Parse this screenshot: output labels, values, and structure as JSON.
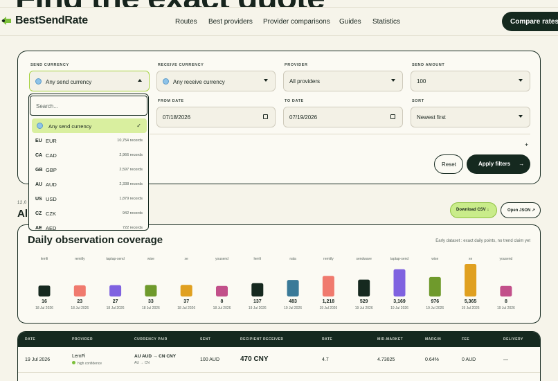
{
  "hero": {
    "title": "Find the exact quote"
  },
  "nav": {
    "brand": "BestSendRate",
    "links": [
      "Routes",
      "Best providers",
      "Provider comparisons",
      "Guides",
      "Statistics"
    ],
    "cta": "Compare rates"
  },
  "filters": {
    "send_currency": {
      "label": "SEND CURRENCY",
      "value": "Any send currency"
    },
    "receive_currency": {
      "label": "RECEIVE CURRENCY",
      "value": "Any receive currency"
    },
    "provider": {
      "label": "PROVIDER",
      "value": "All providers"
    },
    "send_amount": {
      "label": "SEND AMOUNT",
      "value": "100"
    },
    "from_date": {
      "label": "FROM DATE",
      "value": "07/18/2026"
    },
    "to_date": {
      "label": "TO DATE",
      "value": "07/19/2026"
    },
    "sort": {
      "label": "SORT",
      "value": "Newest first"
    },
    "plus": "+",
    "reset": "Reset",
    "apply": "Apply filters",
    "apply_arrow": "→"
  },
  "dropdown": {
    "placeholder": "Search...",
    "selected": "Any send currency",
    "check": "✓",
    "items": [
      {
        "flag": "EU",
        "code": "EUR",
        "records": "10,754 records"
      },
      {
        "flag": "CA",
        "code": "CAD",
        "records": "2,966 records"
      },
      {
        "flag": "GB",
        "code": "GBP",
        "records": "2,597 records"
      },
      {
        "flag": "AU",
        "code": "AUD",
        "records": "2,338 records"
      },
      {
        "flag": "US",
        "code": "USD",
        "records": "1,879 records"
      },
      {
        "flag": "CZ",
        "code": "CZK",
        "records": "942 records"
      },
      {
        "flag": "AE",
        "code": "AED",
        "records": "722 records"
      }
    ]
  },
  "results": {
    "count": "12,0",
    "title": "All",
    "download_csv": "Download CSV ↓",
    "open_json": "Open JSON ↗"
  },
  "coverage": {
    "title": "Daily observation coverage",
    "note": "Early dataset : exact daily points, no trend claim yet"
  },
  "chart_data": {
    "type": "bar",
    "categories": [
      "lemfi",
      "remitly",
      "taptap-send",
      "wise",
      "xe",
      "yousend",
      "lemfi",
      "nala",
      "remitly",
      "sendwave",
      "taptap-send",
      "wise",
      "xe",
      "yousend"
    ],
    "dates": [
      "18 Jul 2026",
      "18 Jul 2026",
      "18 Jul 2026",
      "18 Jul 2026",
      "18 Jul 2026",
      "18 Jul 2026",
      "19 Jul 2026",
      "19 Jul 2026",
      "19 Jul 2026",
      "19 Jul 2026",
      "19 Jul 2026",
      "19 Jul 2026",
      "19 Jul 2026",
      "19 Jul 2026"
    ],
    "values": [
      16,
      23,
      27,
      33,
      37,
      8,
      137,
      483,
      1218,
      529,
      3169,
      976,
      5365,
      8
    ],
    "value_labels": [
      "16",
      "23",
      "27",
      "33",
      "37",
      "8",
      "137",
      "483",
      "1,218",
      "529",
      "3,169",
      "976",
      "5,365",
      "8"
    ],
    "colors": [
      "#16291f",
      "#f07a6e",
      "#7f62e0",
      "#6f9a2c",
      "#e0a020",
      "#c2508a",
      "#16291f",
      "#3a7a98",
      "#f07a6e",
      "#16291f",
      "#7f62e0",
      "#6f9a2c",
      "#e0a020",
      "#c2508a"
    ],
    "title": "Daily observation coverage",
    "xlabel": "",
    "ylabel": ""
  },
  "table": {
    "headers": [
      "DATE",
      "PROVIDER",
      "CURRENCY PAIR",
      "SENT",
      "RECIPIENT RECEIVED",
      "RATE",
      "MID-MARKET",
      "MARGIN",
      "FEE",
      "DELIVERY"
    ],
    "rows": [
      {
        "date": "19 Jul 2026",
        "provider": "LemFi",
        "confidence": "high confidence",
        "pair": "AU AUD → CN CNY",
        "pair_sub": "AU → CN",
        "sent": "100 AUD",
        "received": "470 CNY",
        "rate": "4.7",
        "mid": "4.73025",
        "margin": "0.64%",
        "fee": "0 AUD",
        "delivery": "—"
      }
    ]
  }
}
